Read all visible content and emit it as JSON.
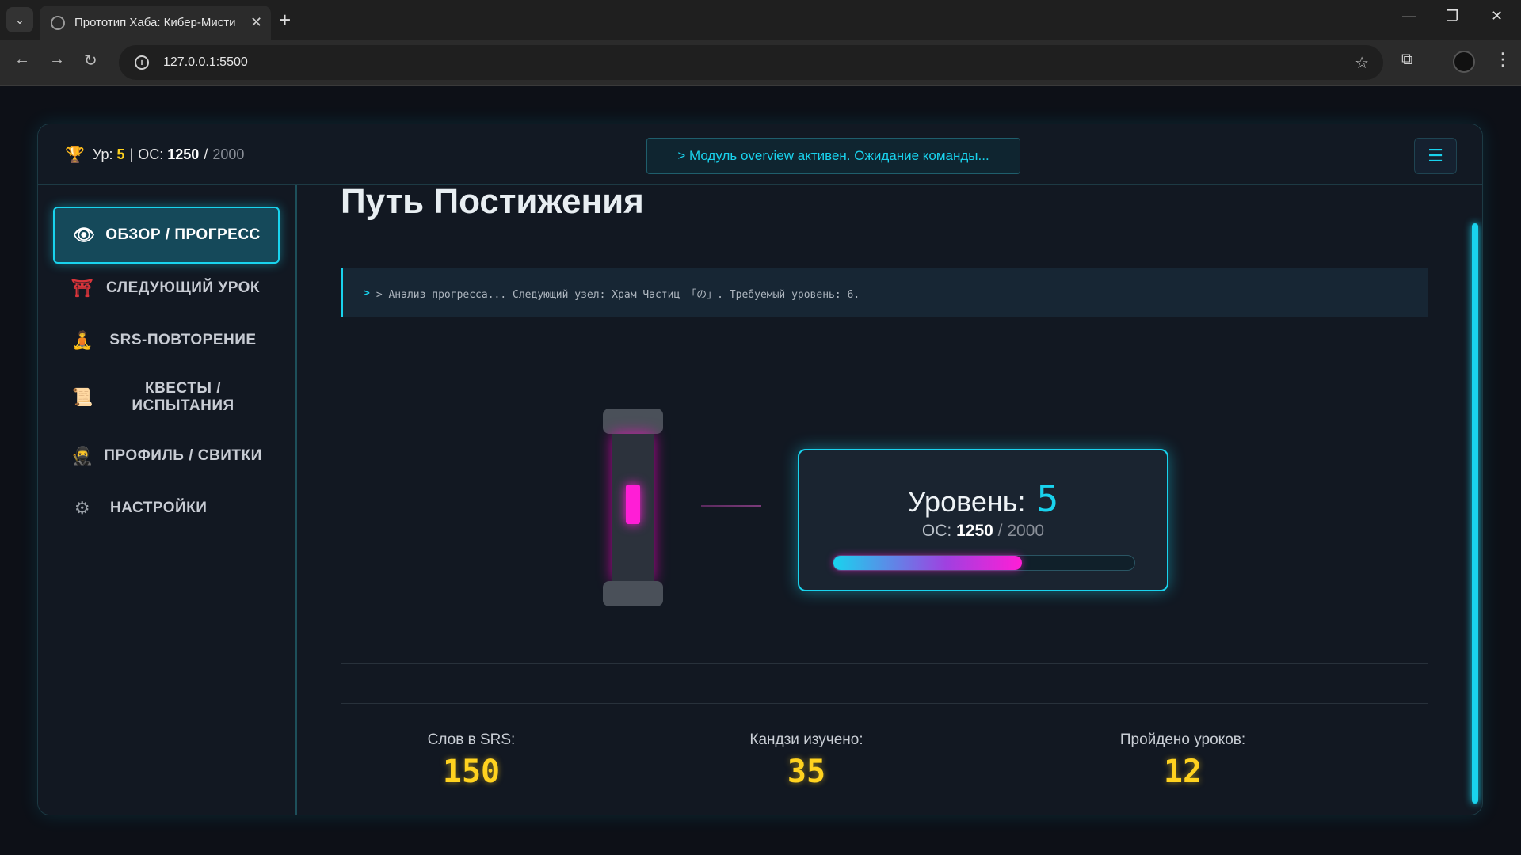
{
  "browser": {
    "tab_title": "Прототип Хаба: Кибер-Мисти",
    "url": "127.0.0.1:5500"
  },
  "header": {
    "level_label": "Ур:",
    "level_value": "5",
    "os_label": "ОС:",
    "os_current": "1250",
    "os_separator": "/",
    "os_max": "2000",
    "console_message": "> Модуль overview активен. Ожидание команды..."
  },
  "sidebar": {
    "items": [
      {
        "label": "ОБЗОР / ПРОГРЕСС",
        "icon": "eye-icon",
        "active": true
      },
      {
        "label": "СЛЕДУЮЩИЙ УРОК",
        "icon": "torii-gate-icon",
        "active": false
      },
      {
        "label": "SRS-ПОВТОРЕНИЕ",
        "icon": "meditation-icon",
        "active": false
      },
      {
        "label": "КВЕСТЫ / ИСПЫТАНИЯ",
        "icon": "scroll-icon",
        "active": false
      },
      {
        "label": "ПРОФИЛЬ / СВИТКИ",
        "icon": "ninja-icon",
        "active": false
      },
      {
        "label": "НАСТРОЙКИ",
        "icon": "gear-icon",
        "active": false
      }
    ]
  },
  "main": {
    "title": "Путь Постижения",
    "log_text": "> Анализ прогресса... Следующий узел: Храм Частиц 「の」. Требуемый уровень: 6.",
    "level_card": {
      "level_label": "Уровень:",
      "level_value": "5",
      "os_label": "ОС:",
      "os_current": "1250",
      "os_separator": "/",
      "os_max": "2000",
      "progress_fraction": 0.625
    },
    "stats": [
      {
        "label": "Слов в SRS:",
        "value": "150"
      },
      {
        "label": "Кандзи изучено:",
        "value": "35"
      },
      {
        "label": "Пройдено уроков:",
        "value": "12"
      }
    ]
  },
  "colors": {
    "accent_cyan": "#19d3ee",
    "accent_magenta": "#ff1ed6",
    "accent_yellow": "#ffd21f",
    "background": "#0d1017"
  }
}
